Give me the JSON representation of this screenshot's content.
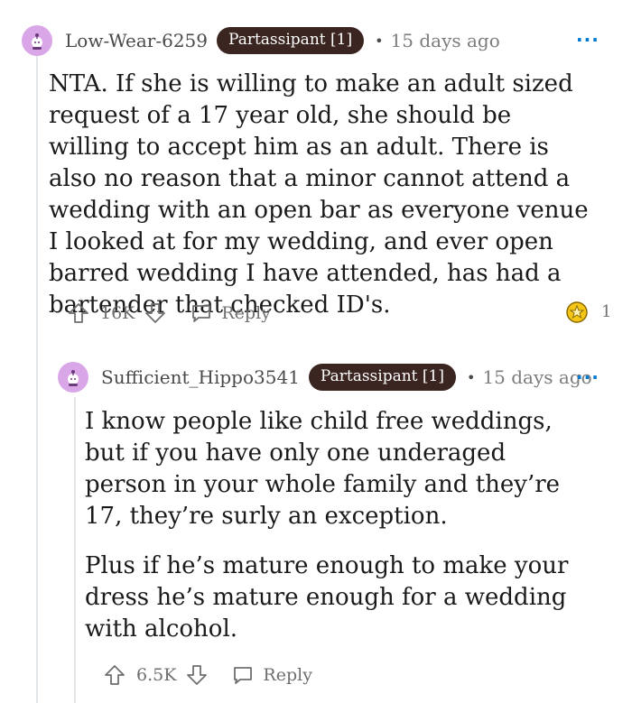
{
  "comment1": {
    "username": "Low-Wear-6259",
    "flair": "Partassipant [1]",
    "separator": "•",
    "time": "15 days ago",
    "more": "···",
    "body": "NTA. If she is willing to make an adult sized request of a 17 year old, she should be willing to accept him as an adult. There is also no reason that a minor cannot attend a wedding with an open bar as everyone venue I looked at for my wedding, and ever open barred wedding I have attended, has had a bartender that checked ID's.",
    "upvotes": "16K",
    "reply_label": "Reply",
    "award_count": "1"
  },
  "comment2": {
    "username": "Sufficient_Hippo3541",
    "flair": "Partassipant [1]",
    "separator": "•",
    "time": "15 days ago",
    "more": "···",
    "paragraph1": "I know people like child free weddings, but if you have only one underaged person in your whole family and they’re 17, they’re surly an exception.",
    "paragraph2": "Plus if he’s mature enough to make your dress he’s mature enough for a wedding with alcohol.",
    "upvotes": "6.5K",
    "reply_label": "Reply"
  },
  "colors": {
    "flair_bg": "#3a2520",
    "avatar_bg": "#d9a6e8",
    "more_dots": "#0079d3",
    "thread_line": "#e3e6e8"
  },
  "icons": [
    "snoo-avatar-icon",
    "upvote-arrow-icon",
    "downvote-arrow-icon",
    "comment-bubble-icon",
    "award-icon",
    "more-options-icon"
  ]
}
